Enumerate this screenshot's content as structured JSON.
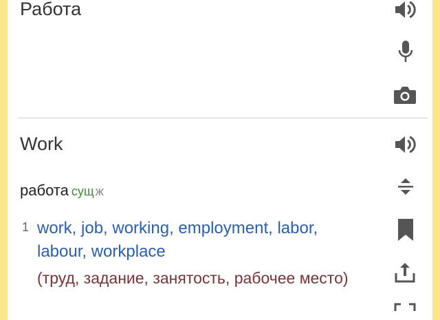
{
  "source": {
    "text": "Работа"
  },
  "translation": {
    "text": "Work",
    "lemma": "работа",
    "pos": "сущ",
    "gender": "ж",
    "sense_number": "1",
    "sense_translations": "work, job, working, employment, labor, labour, workplace",
    "sense_russian": "(труд, задание, занятость, рабочее место)"
  },
  "colors": {
    "frame": "#FDE68A",
    "icon": "#555555",
    "translation_link": "#2b5fb0",
    "russian_gloss": "#7a3434",
    "pos_tag": "#3f8f3a"
  },
  "icons": [
    "speaker-icon",
    "microphone-icon",
    "camera-icon",
    "speaker-icon",
    "expand-collapse-icon",
    "bookmark-icon",
    "share-icon",
    "fullscreen-icon"
  ]
}
